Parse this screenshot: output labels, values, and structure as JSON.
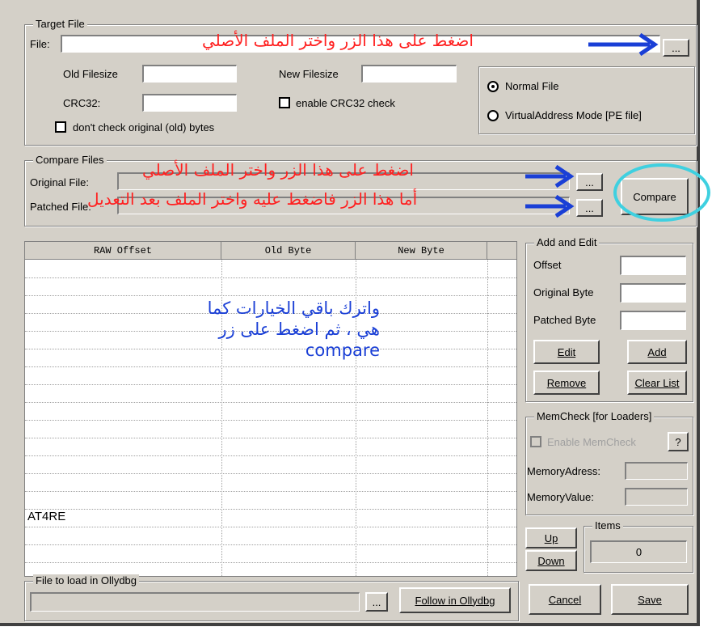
{
  "target_file": {
    "group_title": "Target File",
    "file_label": "File:",
    "file_value": "",
    "browse_button": "...",
    "old_filesize_label": "Old Filesize",
    "new_filesize_label": "New Filesize",
    "crc32_label": "CRC32:",
    "enable_crc32_label": "enable CRC32 check",
    "dont_check_label": "don't check original (old) bytes",
    "normal_file_label": "Normal File",
    "virtual_address_label": "VirtualAddress Mode [PE file]"
  },
  "compare_files": {
    "group_title": "Compare Files",
    "original_label": "Original File:",
    "patched_label": "Patched File:",
    "browse_original": "...",
    "browse_patched": "...",
    "compare_button": "Compare"
  },
  "annotations": {
    "arrow_text_1": "اضغط على هذا الزر واختر الملف الأصلي",
    "arrow_text_2": "اضغط على هذا الزر واختر الملف الأصلي",
    "arrow_text_3": "أما هذا الزر فاضغط عليه واختر الملف بعد التعديل",
    "center_note_1": "واترك باقي الخيارات كما",
    "center_note_2": "هي ، ثم اضغط على زر",
    "center_note_3": "compare",
    "watermark": "AT4RE"
  },
  "table": {
    "columns": [
      "RAW Offset",
      "Old Byte",
      "New Byte"
    ],
    "rows": []
  },
  "add_edit": {
    "group_title": "Add and Edit",
    "offset_label": "Offset",
    "original_byte_label": "Original Byte",
    "patched_byte_label": "Patched Byte",
    "edit_button": "Edit",
    "add_button": "Add",
    "remove_button": "Remove",
    "clear_list_button": "Clear List"
  },
  "memcheck": {
    "group_title": "MemCheck [for Loaders]",
    "enable_label": "Enable MemCheck",
    "help_button": "?",
    "memory_address_label": "MemoryAdress:",
    "memory_value_label": "MemoryValue:"
  },
  "items": {
    "group_title": "Items",
    "up_button": "Up",
    "down_button": "Down",
    "count": "0"
  },
  "ollydbg": {
    "group_title": "File to load in Ollydbg",
    "browse_button": "...",
    "follow_button": "Follow in Ollydbg"
  },
  "footer": {
    "cancel_button": "Cancel",
    "save_button": "Save"
  },
  "colors": {
    "window_bg": "#d4d0c8",
    "annotation_red": "#ff2020",
    "annotation_blue": "#1a3fd6",
    "highlight_circle": "#3fd0e0"
  }
}
